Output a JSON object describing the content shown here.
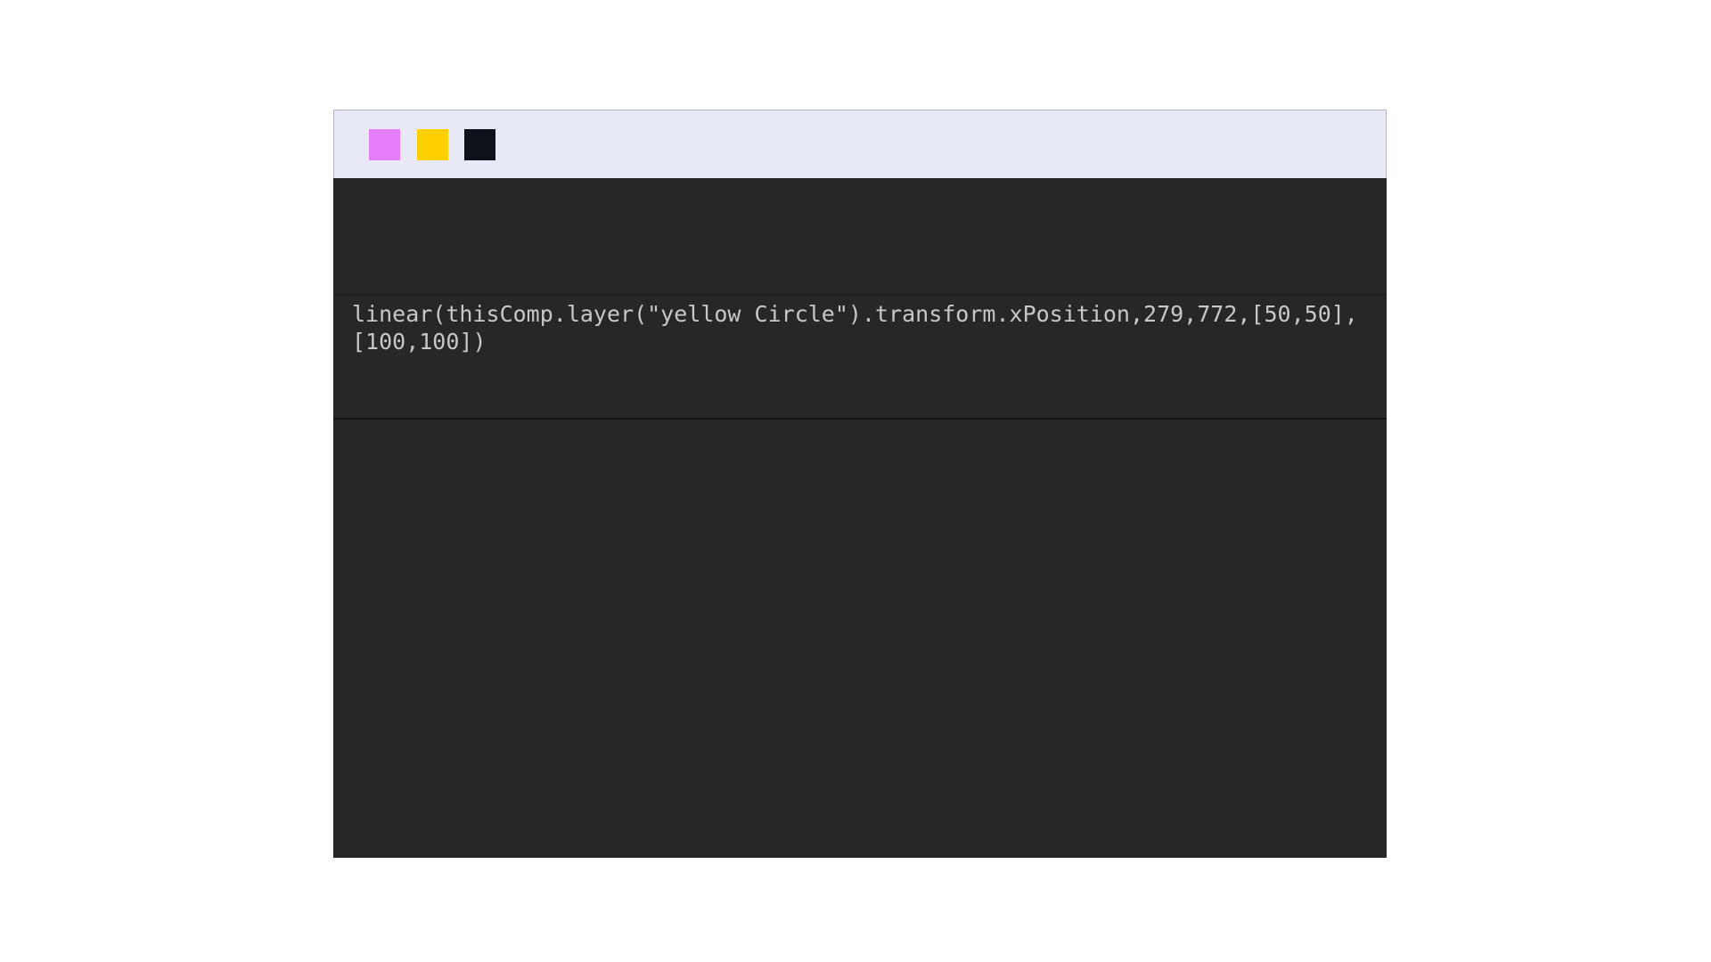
{
  "colors": {
    "page_background": "#ffffff",
    "titlebar_background": "#e7e9f7",
    "editor_background": "#272727",
    "code_text": "#c8c8c8",
    "dot_pink": "#e57cf8",
    "dot_yellow": "#ffd000",
    "dot_dark": "#0f111a"
  },
  "window": {
    "controls": [
      {
        "icon": "window-dot-pink-icon",
        "color": "#e57cf8"
      },
      {
        "icon": "window-dot-yellow-icon",
        "color": "#ffd000"
      },
      {
        "icon": "window-dot-dark-icon",
        "color": "#0f111a"
      }
    ]
  },
  "editor": {
    "code": "linear(thisComp.layer(\"yellow Circle\").transform.xPosition,279,772,[50,50],\n[100,100])"
  }
}
